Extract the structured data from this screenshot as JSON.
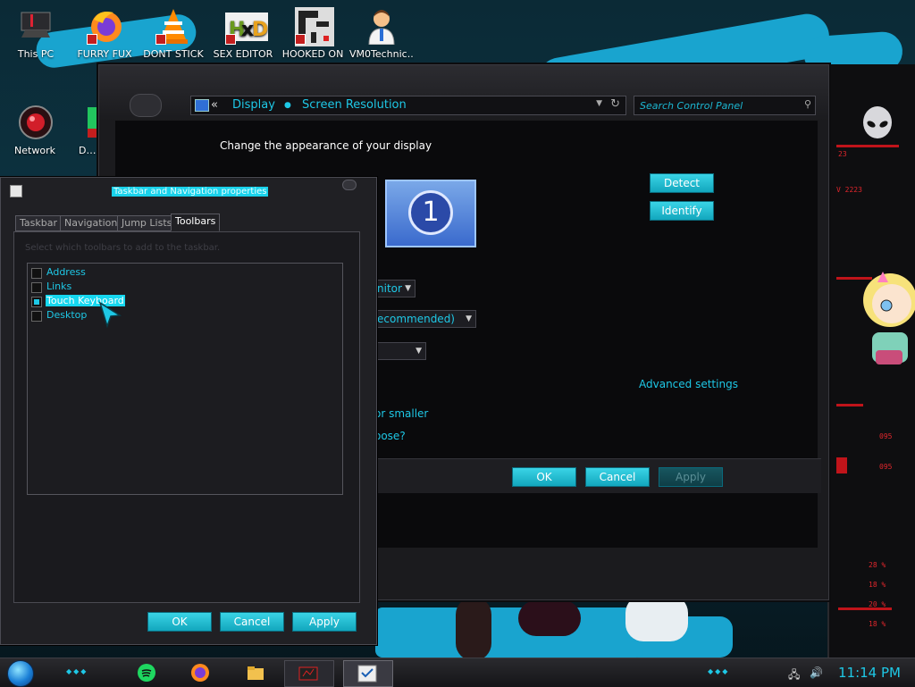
{
  "desktop_icons": [
    {
      "label": "This PC",
      "icon": "computer-icon"
    },
    {
      "label": "FURRY FUX",
      "icon": "firefox-icon"
    },
    {
      "label": "DONT STICK",
      "icon": "vlc-icon"
    },
    {
      "label": "SEX EDITOR",
      "icon": "hxd-icon"
    },
    {
      "label": "HOOKED ON",
      "icon": "game-icon"
    },
    {
      "label": "VM0Technic...",
      "icon": "doctor-icon"
    },
    {
      "label": "Network",
      "icon": "network-icon"
    },
    {
      "label": "D… DUM",
      "icon": "app-icon"
    }
  ],
  "display_window": {
    "breadcrumb_prefix": "«",
    "breadcrumb": [
      "Display",
      "Screen Resolution"
    ],
    "search_placeholder": "Search Control Panel",
    "heading": "Change the appearance of your display",
    "monitor_number": "1",
    "detect_label": "Detect",
    "identify_label": "Identify",
    "display_dropdown": "nitor",
    "resolution_dropdown": "ecommended)",
    "orientation_dropdown": "",
    "advanced_settings": "Advanced settings",
    "text_size_link": "or smaller",
    "choose_link": "oose?",
    "ok_label": "OK",
    "cancel_label": "Cancel",
    "apply_label": "Apply"
  },
  "properties_dialog": {
    "title": "Taskbar and Navigation properties",
    "tabs": [
      {
        "label": "Taskbar",
        "active": false
      },
      {
        "label": "Navigation",
        "active": false
      },
      {
        "label": "Jump Lists",
        "active": false
      },
      {
        "label": "Toolbars",
        "active": true
      }
    ],
    "description": "Select which toolbars to add to the taskbar.",
    "toolbars": [
      {
        "label": "Address",
        "checked": false,
        "selected": false
      },
      {
        "label": "Links",
        "checked": false,
        "selected": false
      },
      {
        "label": "Touch Keyboard",
        "checked": true,
        "selected": true
      },
      {
        "label": "Desktop",
        "checked": false,
        "selected": false
      }
    ],
    "ok_label": "OK",
    "cancel_label": "Cancel",
    "apply_label": "Apply"
  },
  "wallpaper_readouts": [
    "23",
    "V 2223",
    "095",
    "095",
    "28 %",
    "18 %",
    "20 %",
    "18 %"
  ],
  "taskbar": {
    "clock": "11:14 PM",
    "apps": [
      "spotify-icon",
      "firefox-icon",
      "explorer-icon",
      "hooked-game-icon",
      "properties-icon"
    ],
    "tray_icons": [
      "network-tray-icon",
      "volume-icon"
    ]
  },
  "colors": {
    "accent": "#1ec8e6",
    "warning_red": "#e0262c"
  }
}
